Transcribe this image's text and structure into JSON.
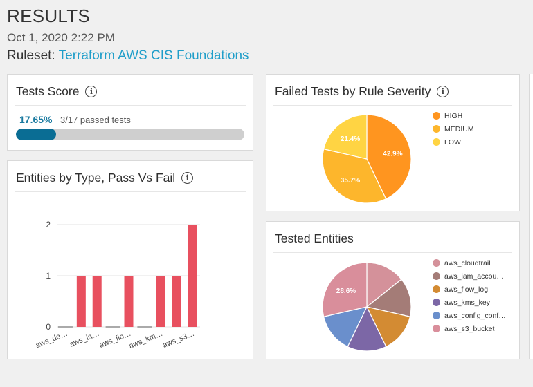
{
  "header": {
    "title": "RESULTS",
    "date": "Oct 1, 2020 2:22 PM",
    "ruleset_label": "Ruleset:",
    "ruleset_link": "Terraform AWS CIS Foundations"
  },
  "tests_score": {
    "title": "Tests Score",
    "percent_text": "17.65%",
    "passed_text": "3/17 passed tests",
    "progress_fraction": 0.1765,
    "bar_color": "#0a6d94",
    "track_color": "#cfcfcf"
  },
  "entities_by_type": {
    "title": "Entities by Type, Pass Vs Fail"
  },
  "failed_by_severity": {
    "title": "Failed Tests by Rule Severity"
  },
  "tested_entities": {
    "title": "Tested Entities"
  },
  "chart_data": [
    {
      "type": "bar",
      "title": "Entities by Type, Pass Vs Fail",
      "categories": [
        "aws_de…",
        "",
        "aws_ia…",
        "",
        "aws_flo…",
        "",
        "aws_km…",
        "",
        "aws_s3…"
      ],
      "series": [
        {
          "color": "#e8505f",
          "values": [
            0,
            1,
            1,
            0,
            1,
            0,
            1,
            1,
            2
          ]
        }
      ],
      "ylim": [
        0,
        2
      ],
      "yticks": [
        "0",
        "1",
        "2"
      ],
      "grid": true
    },
    {
      "type": "pie",
      "title": "Failed Tests by Rule Severity",
      "labels": [
        "HIGH",
        "MEDIUM",
        "LOW"
      ],
      "values": [
        42.9,
        35.7,
        21.4
      ],
      "slice_labels": [
        "42.9%",
        "35.7%",
        "21.4%"
      ],
      "colors": [
        "#ff951f",
        "#fdb62c",
        "#ffd443"
      ],
      "legend": "right"
    },
    {
      "type": "pie",
      "title": "Tested Entities",
      "labels": [
        "aws_cloudtrail",
        "aws_iam_accou…",
        "aws_flow_log",
        "aws_kms_key",
        "aws_config_conf…",
        "aws_s3_bucket"
      ],
      "values": [
        14.3,
        14.3,
        14.3,
        14.3,
        14.3,
        28.6
      ],
      "slice_labels": [
        "",
        "",
        "",
        "",
        "",
        "28.6%"
      ],
      "colors": [
        "#d4919a",
        "#a47c77",
        "#d38b33",
        "#7c67a6",
        "#6a8fcc",
        "#d98e9b"
      ],
      "legend": "right"
    }
  ]
}
